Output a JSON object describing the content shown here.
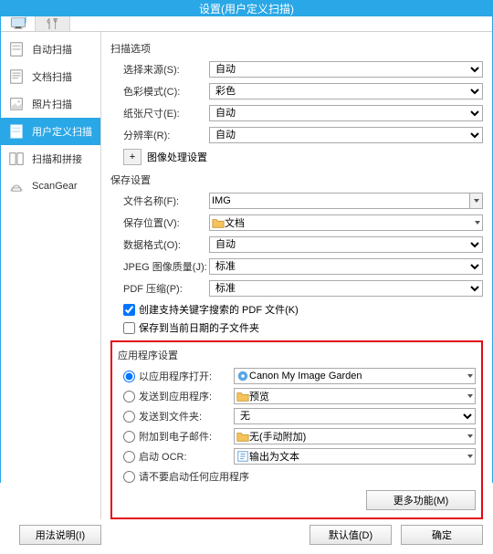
{
  "title": "设置(用户定义扫描)",
  "sidebar": {
    "items": [
      {
        "label": "自动扫描"
      },
      {
        "label": "文档扫描"
      },
      {
        "label": "照片扫描"
      },
      {
        "label": "用户定义扫描"
      },
      {
        "label": "扫描和拼接"
      },
      {
        "label": "ScanGear"
      }
    ]
  },
  "scan": {
    "group_title": "扫描选项",
    "source": {
      "label": "选择来源(S):",
      "value": "自动"
    },
    "colormode": {
      "label": "色彩模式(C):",
      "value": "彩色"
    },
    "papersize": {
      "label": "纸张尺寸(E):",
      "value": "自动"
    },
    "resolution": {
      "label": "分辨率(R):",
      "value": "自动"
    },
    "imgproc": {
      "label": "图像处理设置"
    }
  },
  "save": {
    "group_title": "保存设置",
    "filename": {
      "label": "文件名称(F):",
      "value": "IMG"
    },
    "saveto": {
      "label": "保存位置(V):",
      "value": "文档"
    },
    "format": {
      "label": "数据格式(O):",
      "value": "自动"
    },
    "jpegq": {
      "label": "JPEG 图像质量(J):",
      "value": "标准"
    },
    "pdfc": {
      "label": "PDF 压缩(P):",
      "value": "标准"
    },
    "chk_kw": "创建支持关键字搜索的 PDF 文件(K)",
    "chk_date": "保存到当前日期的子文件夹"
  },
  "app": {
    "group_title": "应用程序设置",
    "openwith": {
      "label": "以应用程序打开:",
      "value": "Canon My Image Garden"
    },
    "sendto_app": {
      "label": "发送到应用程序:",
      "value": "预览"
    },
    "sendto_folder": {
      "label": "发送到文件夹:",
      "value": "无"
    },
    "attach": {
      "label": "附加到电子邮件:",
      "value": "无(手动附加)"
    },
    "ocr": {
      "label": "启动 OCR:",
      "value": "输出为文本"
    },
    "none": {
      "label": "请不要启动任何应用程序"
    },
    "more": "更多功能(M)"
  },
  "footer": {
    "help": "用法说明(I)",
    "defaults": "默认值(D)",
    "ok": "确定"
  },
  "plus": "+"
}
